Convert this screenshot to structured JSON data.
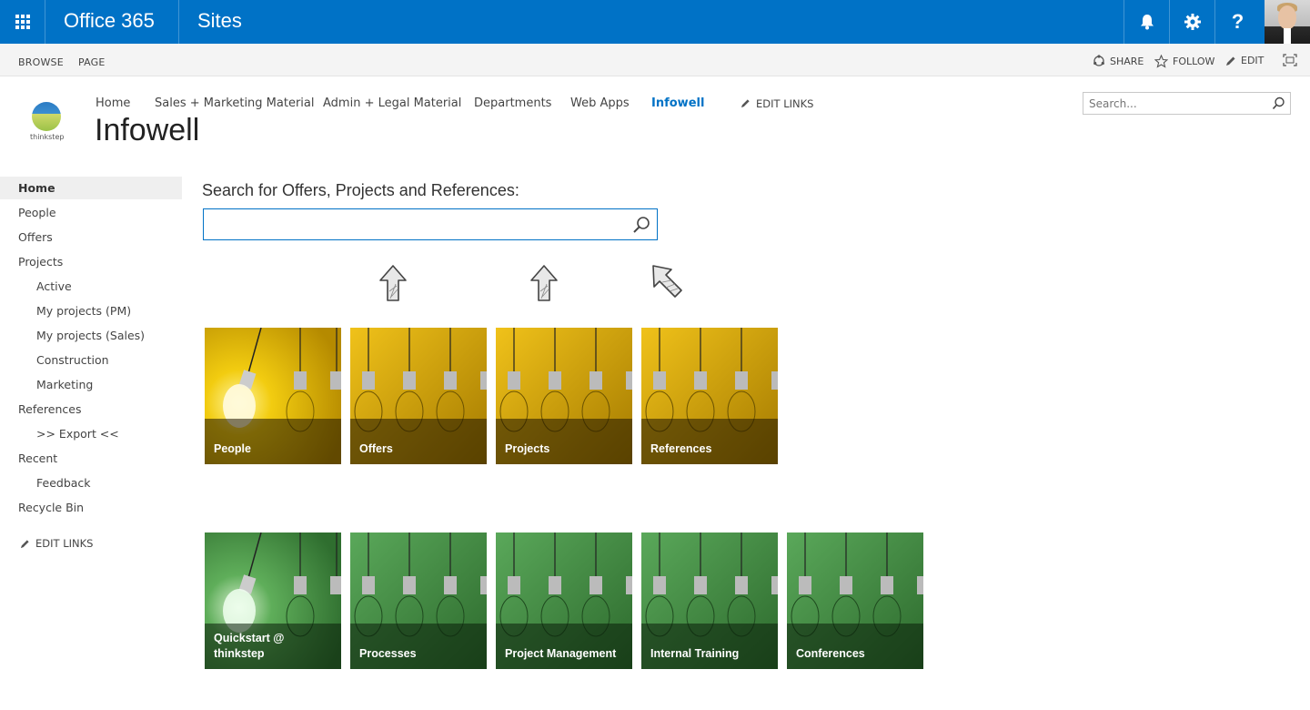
{
  "suitebar": {
    "brand": "Office 365",
    "app_title": "Sites",
    "help_label": "?"
  },
  "ribbon": {
    "tabs": [
      "BROWSE",
      "PAGE"
    ],
    "share": "SHARE",
    "follow": "FOLLOW",
    "edit": "EDIT"
  },
  "header": {
    "logo_text": "thinkstep",
    "nav": [
      "Home",
      "Sales + Marketing Material",
      "Admin + Legal Material",
      "Departments",
      "Web Apps",
      "Infowell"
    ],
    "active_nav": "Infowell",
    "edit_links": "EDIT LINKS",
    "title": "Infowell",
    "search_placeholder": "Search..."
  },
  "leftnav": {
    "items": [
      {
        "label": "Home",
        "selected": true
      },
      {
        "label": "People"
      },
      {
        "label": "Offers"
      },
      {
        "label": "Projects"
      },
      {
        "label": "Active",
        "sub": true
      },
      {
        "label": "My projects (PM)",
        "sub": true
      },
      {
        "label": "My projects (Sales)",
        "sub": true
      },
      {
        "label": "Construction",
        "sub": true
      },
      {
        "label": "Marketing",
        "sub": true
      },
      {
        "label": "References"
      },
      {
        "label": ">> Export <<",
        "sub": true
      },
      {
        "label": "Recent"
      },
      {
        "label": "Feedback",
        "sub": true
      },
      {
        "label": "Recycle Bin"
      }
    ],
    "edit_links": "EDIT LINKS"
  },
  "main": {
    "search_label": "Search for Offers, Projects and References:",
    "tiles_row1": [
      "People",
      "Offers",
      "Projects",
      "References"
    ],
    "tiles_row2": [
      "Quickstart @ thinkstep",
      "Processes",
      "Project Management",
      "Internal Training",
      "Conferences"
    ]
  },
  "colors": {
    "suitebar": "#0072c6",
    "active_link": "#0072c6",
    "tile_yellow": "#d4a800",
    "tile_green": "#4a9a4a"
  },
  "icons": [
    "waffle-icon",
    "bell-icon",
    "gear-icon",
    "help-icon",
    "share-icon",
    "star-icon",
    "pencil-icon",
    "fullscreen-icon",
    "search-icon",
    "arrow-up-icon",
    "arrow-up-left-icon"
  ]
}
